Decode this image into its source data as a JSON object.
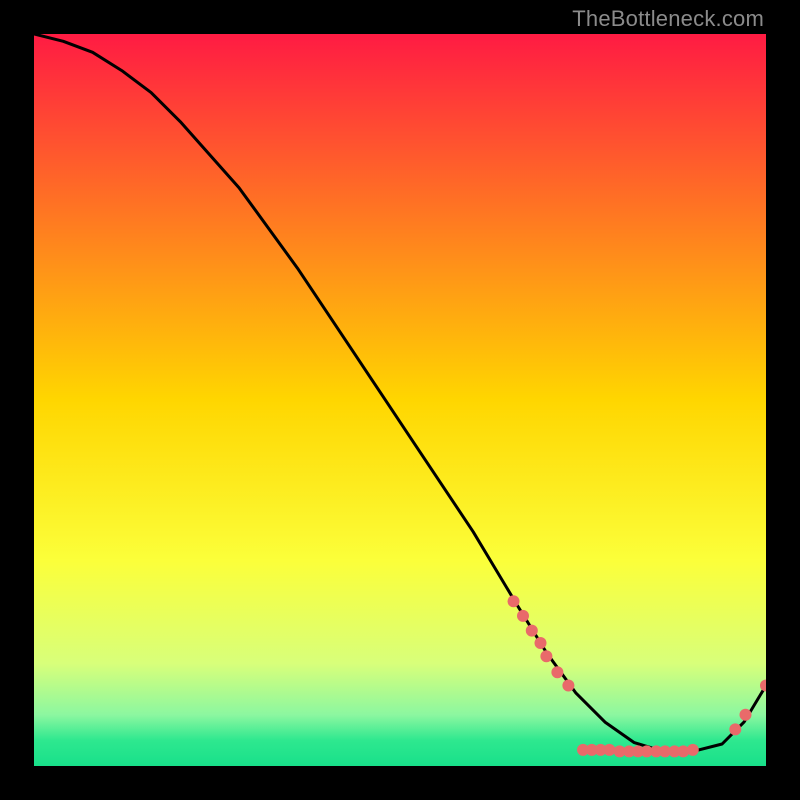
{
  "watermark": "TheBottleneck.com",
  "chart_data": {
    "type": "line",
    "title": "",
    "xlabel": "",
    "ylabel": "",
    "xlim": [
      0,
      100
    ],
    "ylim": [
      0,
      100
    ],
    "grid": false,
    "legend": false,
    "gradient_stops": [
      {
        "pos": 0.0,
        "color": "#ff1b43"
      },
      {
        "pos": 0.5,
        "color": "#ffd600"
      },
      {
        "pos": 0.72,
        "color": "#fbff3a"
      },
      {
        "pos": 0.86,
        "color": "#d8ff7a"
      },
      {
        "pos": 0.93,
        "color": "#8cf7a0"
      },
      {
        "pos": 0.965,
        "color": "#2ee88f"
      },
      {
        "pos": 1.0,
        "color": "#18e08a"
      }
    ],
    "series": [
      {
        "name": "curve",
        "color": "#000000",
        "x": [
          0,
          4,
          8,
          12,
          16,
          20,
          28,
          36,
          44,
          52,
          60,
          66,
          70,
          74,
          78,
          82,
          86,
          90,
          94,
          97,
          100
        ],
        "y": [
          100,
          99,
          97.5,
          95,
          92,
          88,
          79,
          68,
          56,
          44,
          32,
          22,
          15.5,
          10,
          6,
          3.2,
          2,
          2,
          3,
          6,
          11
        ]
      }
    ],
    "markers": {
      "color": "#e96a6a",
      "radius": 6,
      "points": [
        {
          "x": 65.5,
          "y": 22.5
        },
        {
          "x": 66.8,
          "y": 20.5
        },
        {
          "x": 68.0,
          "y": 18.5
        },
        {
          "x": 69.2,
          "y": 16.8
        },
        {
          "x": 70.0,
          "y": 15.0
        },
        {
          "x": 71.5,
          "y": 12.8
        },
        {
          "x": 73.0,
          "y": 11.0
        },
        {
          "x": 75.0,
          "y": 2.2
        },
        {
          "x": 76.2,
          "y": 2.2
        },
        {
          "x": 77.4,
          "y": 2.2
        },
        {
          "x": 78.6,
          "y": 2.2
        },
        {
          "x": 80.0,
          "y": 2.0
        },
        {
          "x": 81.3,
          "y": 2.0
        },
        {
          "x": 82.5,
          "y": 2.0
        },
        {
          "x": 83.7,
          "y": 2.0
        },
        {
          "x": 85.0,
          "y": 2.0
        },
        {
          "x": 86.2,
          "y": 2.0
        },
        {
          "x": 87.5,
          "y": 2.0
        },
        {
          "x": 88.7,
          "y": 2.0
        },
        {
          "x": 90.0,
          "y": 2.2
        },
        {
          "x": 95.8,
          "y": 5.0
        },
        {
          "x": 97.2,
          "y": 7.0
        },
        {
          "x": 100.0,
          "y": 11.0
        }
      ]
    }
  }
}
